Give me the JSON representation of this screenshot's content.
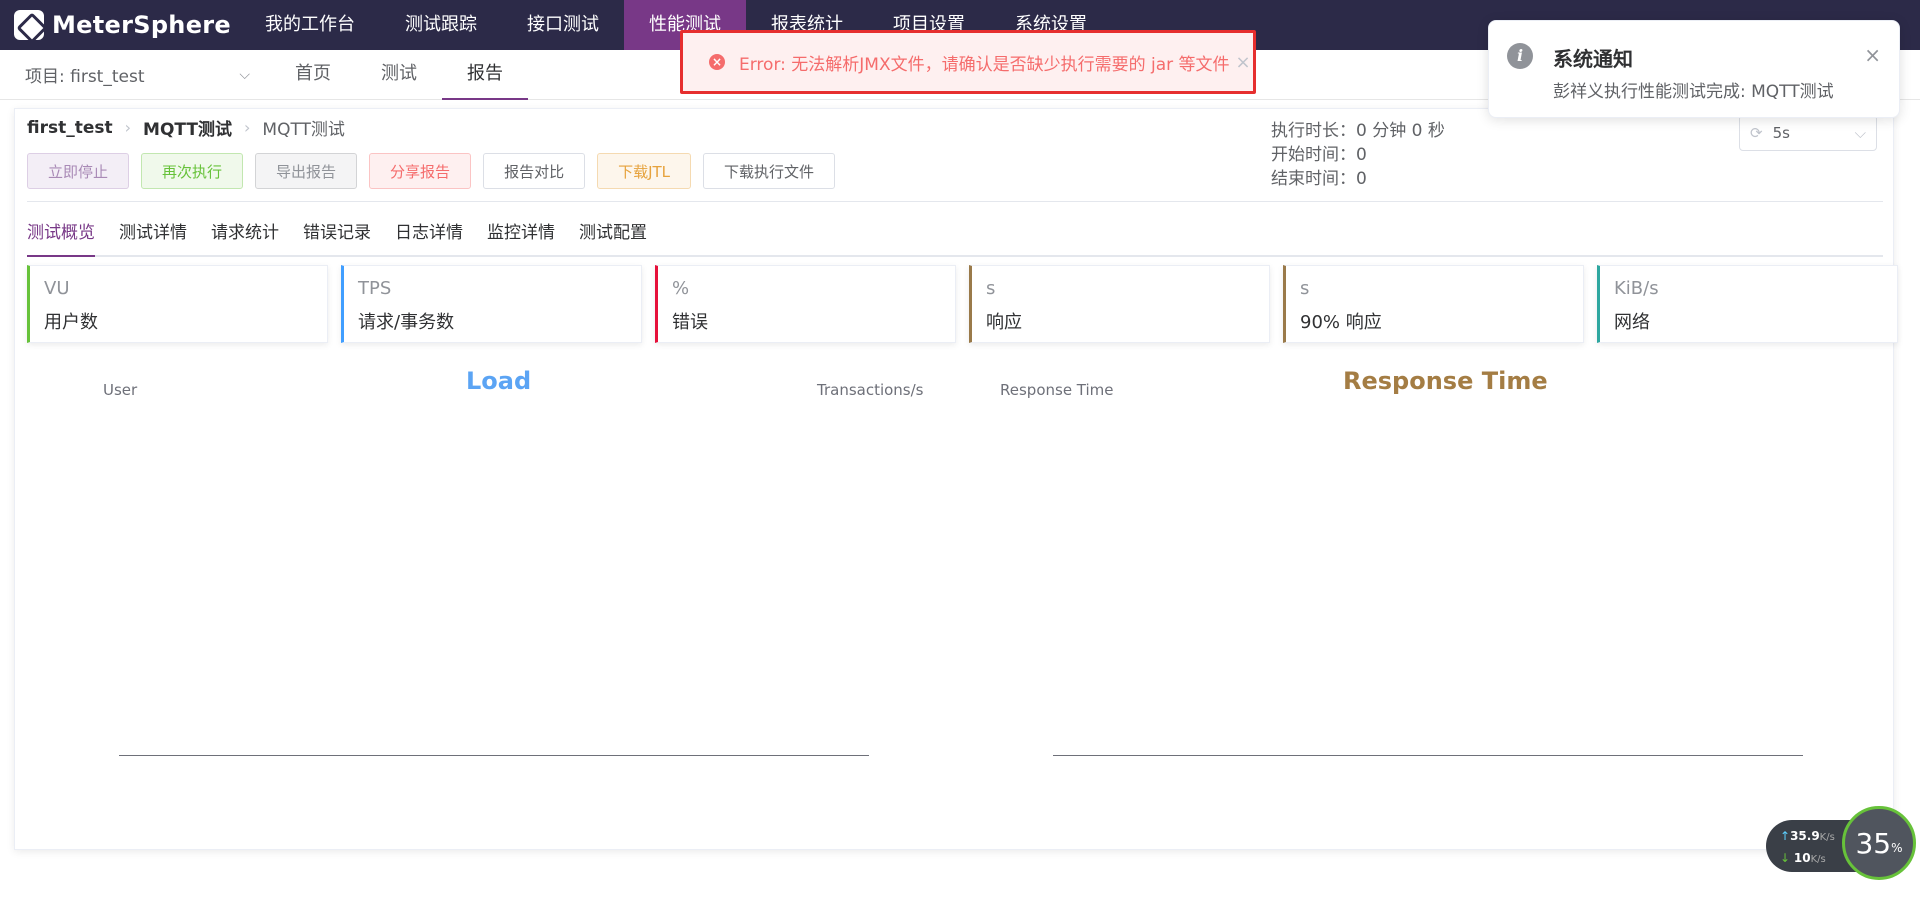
{
  "app": {
    "name": "MeterSphere"
  },
  "topnav": {
    "items": [
      "我的工作台",
      "测试跟踪",
      "接口测试",
      "性能测试",
      "报表统计",
      "项目设置",
      "系统设置"
    ],
    "active_index": 3
  },
  "project_select": {
    "label": "项目: first_test"
  },
  "subnav": {
    "tabs": [
      "首页",
      "测试",
      "报告"
    ],
    "active_index": 2
  },
  "breadcrumb": {
    "project": "first_test",
    "test": "MQTT测试",
    "report": "MQTT测试"
  },
  "buttons": {
    "stop": "立即停止",
    "rerun": "再次执行",
    "export": "导出报告",
    "share": "分享报告",
    "compare": "报告对比",
    "download_jtl": "下载JTL",
    "download_files": "下载执行文件"
  },
  "exec_info": {
    "duration": "执行时长：0 分钟 0 秒",
    "start": "开始时间：0",
    "end": "结束时间：0"
  },
  "refresh": {
    "value": "5s"
  },
  "report_tabs": [
    "测试概览",
    "测试详情",
    "请求统计",
    "错误记录",
    "日志详情",
    "监控详情",
    "测试配置"
  ],
  "metrics": [
    {
      "unit": "VU",
      "label": "用户数",
      "color": "#67c23a"
    },
    {
      "unit": "TPS",
      "label": "请求/事务数",
      "color": "#409eff"
    },
    {
      "unit": "%",
      "label": "错误",
      "color": "#e6103a"
    },
    {
      "unit": "s",
      "label": "响应",
      "color": "#9a7a4a"
    },
    {
      "unit": "s",
      "label": "90% 响应",
      "color": "#9a7a4a"
    },
    {
      "unit": "KiB/s",
      "label": "网络",
      "color": "#2ea7a0"
    }
  ],
  "charts": {
    "load": {
      "title": "Load",
      "y_left": "User",
      "y_right": "Transactions/s",
      "color": "#5ba4f4"
    },
    "response": {
      "title": "Response Time",
      "y_left": "Response Time",
      "color": "#a47d44"
    }
  },
  "error_message": {
    "text": "Error: 无法解析JMX文件，请确认是否缺少执行需要的 jar 等文件"
  },
  "notification": {
    "title": "系统通知",
    "body": "彭祥义执行性能测试完成: MQTT测试"
  },
  "net_widget": {
    "up": "35.9",
    "down": "10",
    "unit": "K/s",
    "cpu": "35",
    "cpu_unit": "%"
  }
}
